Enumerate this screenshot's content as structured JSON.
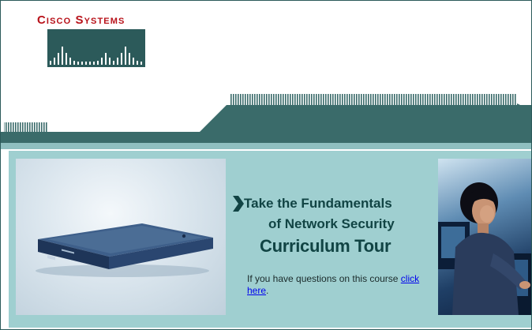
{
  "brand": {
    "logo_text": "Cisco Systems",
    "logo_color": "#b8121a",
    "bars_color": "#2c5a5a"
  },
  "header": {
    "band_color": "#3a6b6a"
  },
  "hero": {
    "title_line1": "Take the Fundamentals",
    "title_line2": "of Network Security",
    "title_line3": "Curriculum Tour",
    "title_color": "#114444",
    "question_text": "If you have questions on this course ",
    "question_link": "click here",
    "question_suffix": ".",
    "background_color": "#9fcfd0"
  },
  "images": {
    "left": "network-appliance-photo",
    "right": "woman-at-computer-photo"
  }
}
